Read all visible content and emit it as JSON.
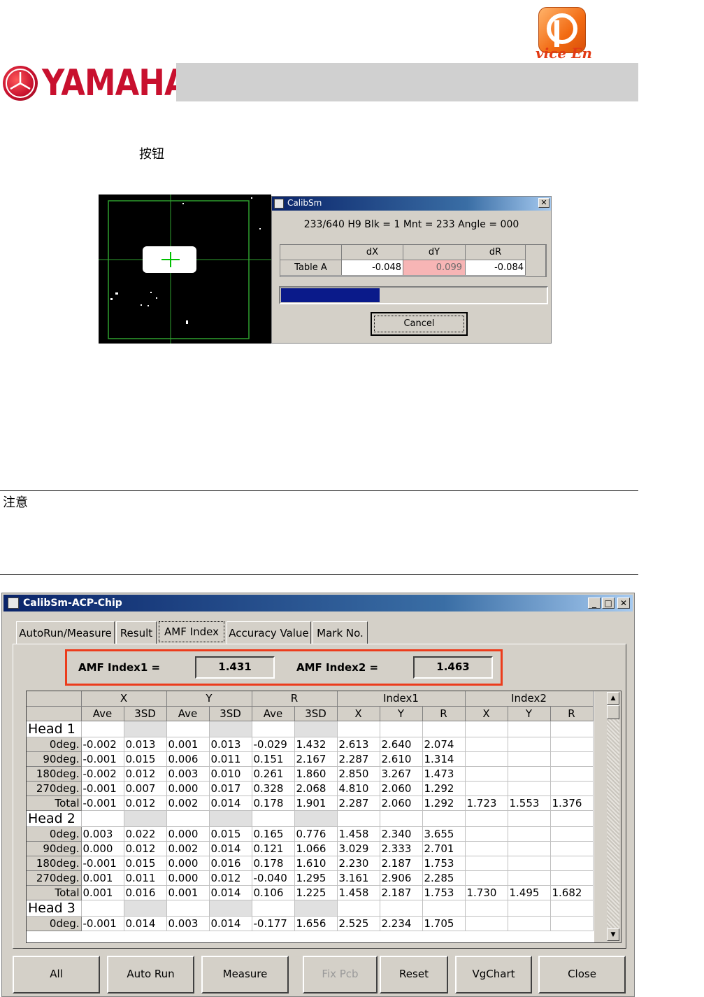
{
  "header": {
    "brand": "YAMAHA",
    "corner_badge_text": "vice En"
  },
  "section_text": {
    "button_word": "按钮",
    "note_heading": "注意"
  },
  "dialog1": {
    "title": "CalibSm",
    "close_glyph": "✕",
    "info_line": "233/640 H9 Blk = 1 Mnt = 233 Angle = 000",
    "table": {
      "headers": [
        "",
        "dX",
        "dY",
        "dR"
      ],
      "row": {
        "label": "Table A",
        "dX": "-0.048",
        "dY": "0.099",
        "dR": "-0.084"
      }
    },
    "progress": 0.37,
    "cancel_label": "Cancel",
    "highlight_color": "#f7b5b5"
  },
  "window2": {
    "title": "CalibSm-ACP-Chip",
    "controls": [
      "_",
      "□",
      "✕"
    ],
    "tabs": [
      "AutoRun/Measure",
      "Result",
      "AMF Index",
      "Accuracy Value",
      "Mark No."
    ],
    "active_tab": "AMF Index",
    "amf": {
      "index1_label": "AMF Index1 =",
      "index1_value": "1.431",
      "index2_label": "AMF Index2 =",
      "index2_value": "1.463",
      "highlight_color": "#ec3c1c"
    },
    "grid": {
      "group_headers": [
        "X",
        "Y",
        "R",
        "Index1",
        "Index2"
      ],
      "sub_headers": [
        "Ave",
        "3SD",
        "Ave",
        "3SD",
        "Ave",
        "3SD",
        "X",
        "Y",
        "R",
        "X",
        "Y",
        "R"
      ],
      "rows": [
        {
          "type": "head",
          "label": "Head 1"
        },
        {
          "label": "0deg.",
          "cells": [
            "-0.002",
            "0.013",
            "0.001",
            "0.013",
            "-0.029",
            "1.432",
            "2.613",
            "2.640",
            "2.074",
            "",
            "",
            ""
          ]
        },
        {
          "label": "90deg.",
          "cells": [
            "-0.001",
            "0.015",
            "0.006",
            "0.011",
            "0.151",
            "2.167",
            "2.287",
            "2.610",
            "1.314",
            "",
            "",
            ""
          ]
        },
        {
          "label": "180deg.",
          "cells": [
            "-0.002",
            "0.012",
            "0.003",
            "0.010",
            "0.261",
            "1.860",
            "2.850",
            "3.267",
            "1.473",
            "",
            "",
            ""
          ]
        },
        {
          "label": "270deg.",
          "cells": [
            "-0.001",
            "0.007",
            "0.000",
            "0.017",
            "0.328",
            "2.068",
            "4.810",
            "2.060",
            "1.292",
            "",
            "",
            ""
          ]
        },
        {
          "label": "Total",
          "cells": [
            "-0.001",
            "0.012",
            "0.002",
            "0.014",
            "0.178",
            "1.901",
            "2.287",
            "2.060",
            "1.292",
            "1.723",
            "1.553",
            "1.376"
          ]
        },
        {
          "type": "head",
          "label": "Head 2"
        },
        {
          "label": "0deg.",
          "cells": [
            "0.003",
            "0.022",
            "0.000",
            "0.015",
            "0.165",
            "0.776",
            "1.458",
            "2.340",
            "3.655",
            "",
            "",
            ""
          ]
        },
        {
          "label": "90deg.",
          "cells": [
            "0.000",
            "0.012",
            "0.002",
            "0.014",
            "0.121",
            "1.066",
            "3.029",
            "2.333",
            "2.701",
            "",
            "",
            ""
          ]
        },
        {
          "label": "180deg.",
          "cells": [
            "-0.001",
            "0.015",
            "0.000",
            "0.016",
            "0.178",
            "1.610",
            "2.230",
            "2.187",
            "1.753",
            "",
            "",
            ""
          ]
        },
        {
          "label": "270deg.",
          "cells": [
            "0.001",
            "0.011",
            "0.000",
            "0.012",
            "-0.040",
            "1.295",
            "3.161",
            "2.906",
            "2.285",
            "",
            "",
            ""
          ]
        },
        {
          "label": "Total",
          "cells": [
            "0.001",
            "0.016",
            "0.001",
            "0.014",
            "0.106",
            "1.225",
            "1.458",
            "2.187",
            "1.753",
            "1.730",
            "1.495",
            "1.682"
          ]
        },
        {
          "type": "head",
          "label": "Head 3"
        },
        {
          "label": "0deg.",
          "cells": [
            "-0.001",
            "0.014",
            "0.003",
            "0.014",
            "-0.177",
            "1.656",
            "2.525",
            "2.234",
            "1.705",
            "",
            "",
            ""
          ]
        }
      ]
    },
    "scroll_up": "▲",
    "scroll_down": "▼",
    "buttons": [
      {
        "label": "All",
        "enabled": true
      },
      {
        "label": "Auto Run",
        "enabled": true
      },
      {
        "label": "Measure",
        "enabled": true
      },
      {
        "label": "Fix Pcb",
        "enabled": false
      },
      {
        "label": "Reset",
        "enabled": true
      },
      {
        "label": "VgChart",
        "enabled": true
      },
      {
        "label": "Close",
        "enabled": true
      }
    ]
  }
}
